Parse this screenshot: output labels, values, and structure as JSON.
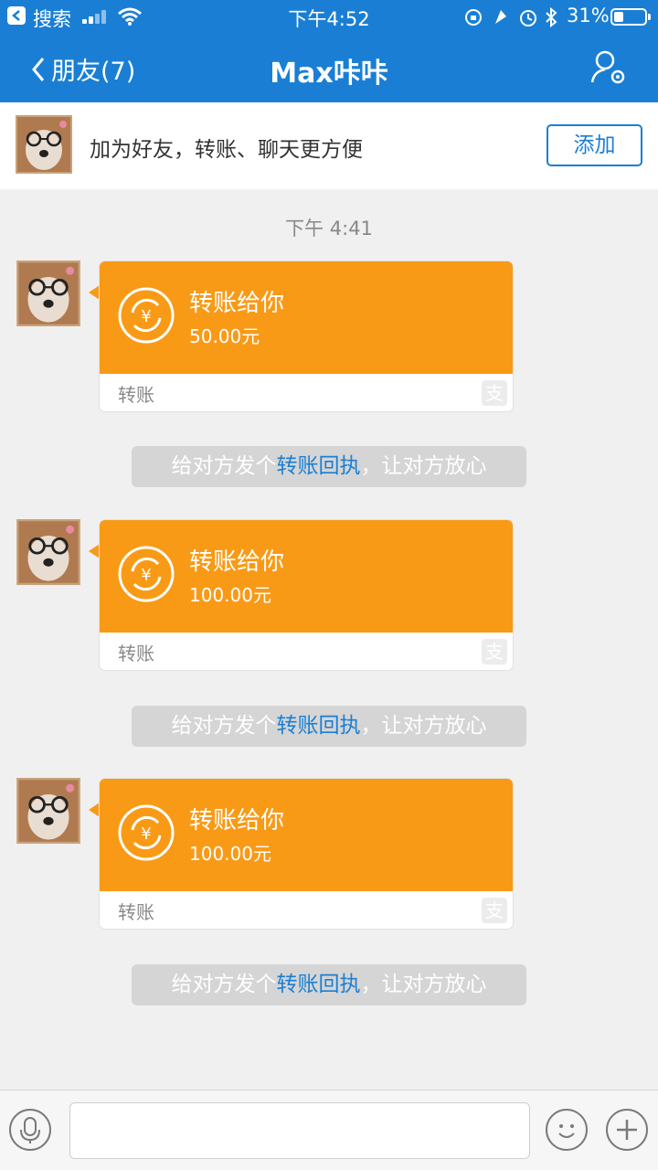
{
  "status_bar": {
    "back_app": "搜索",
    "time": "下午4:52",
    "battery_percent": "31%",
    "icons": [
      "back-app-icon",
      "signal-icon",
      "wifi-icon",
      "orientation-lock-icon",
      "location-icon",
      "alarm-icon",
      "bluetooth-icon",
      "battery-icon"
    ]
  },
  "nav": {
    "back_label": "朋友(7)",
    "title": "Max咔咔",
    "profile_icon": "user-settings-icon"
  },
  "banner": {
    "text": "加为好友，转账、聊天更方便",
    "add_label": "添加"
  },
  "timestamp": "下午 4:41",
  "messages": [
    {
      "title": "转账给你",
      "amount": "50.00元",
      "footer": "转账",
      "brand_icon": "支"
    },
    {
      "title": "转账给你",
      "amount": "100.00元",
      "footer": "转账",
      "brand_icon": "支"
    },
    {
      "title": "转账给你",
      "amount": "100.00元",
      "footer": "转账",
      "brand_icon": "支"
    }
  ],
  "notice": {
    "prefix": "给对方发个",
    "link": "转账回执",
    "suffix": "，让对方放心"
  },
  "colors": {
    "header_blue": "#1a7fd4",
    "transfer_orange": "#f99a16",
    "background": "#f0f0f0"
  },
  "input_bar": {
    "icons": [
      "voice-icon",
      "emoji-icon",
      "plus-icon"
    ]
  }
}
